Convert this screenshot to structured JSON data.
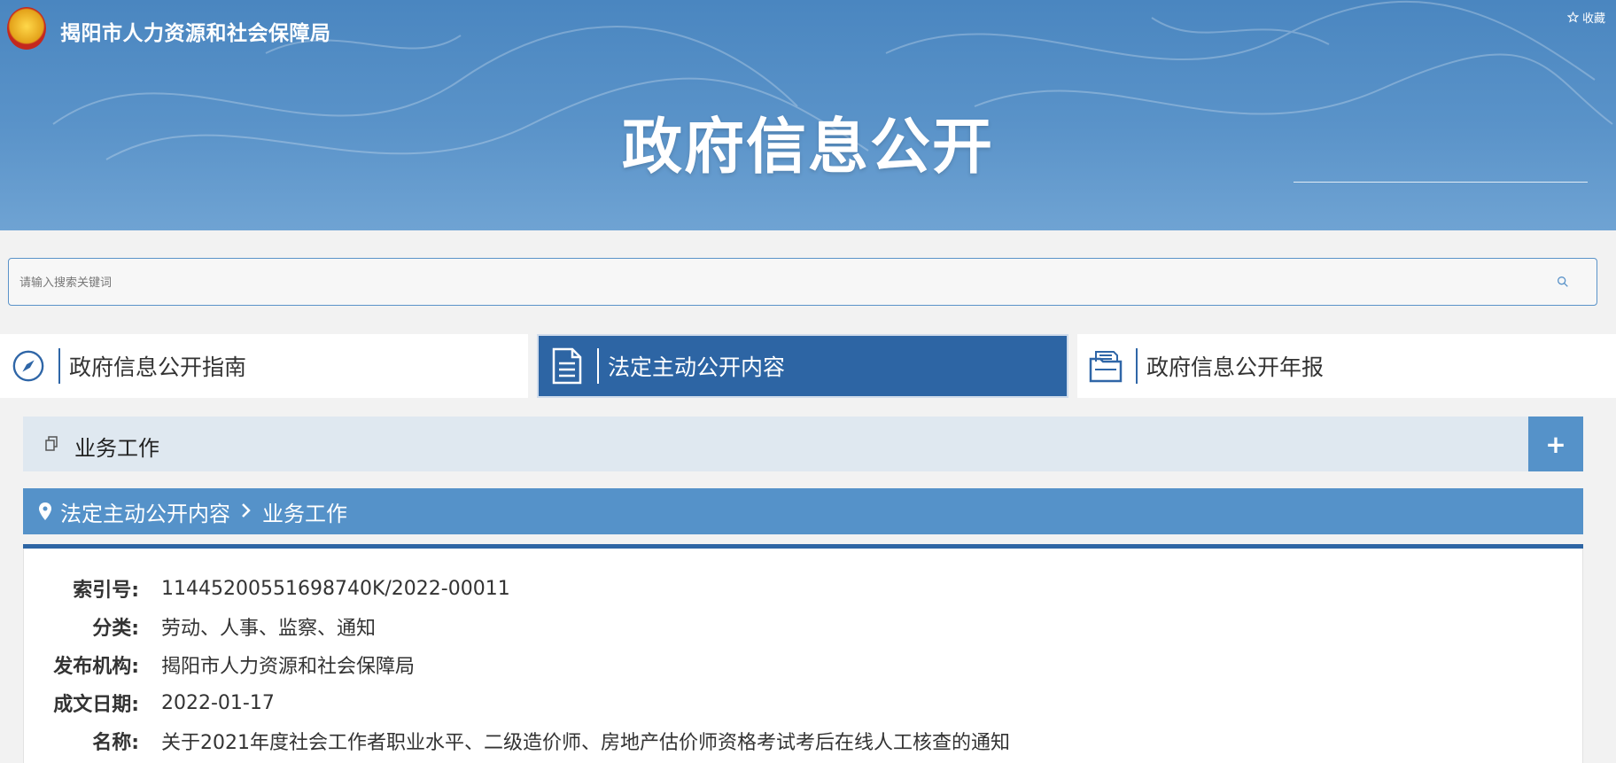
{
  "header": {
    "org_name": "揭阳市人力资源和社会保障局",
    "favorite_label": "收藏",
    "page_title": "政府信息公开"
  },
  "search": {
    "placeholder": "请输入搜索关键词"
  },
  "tabs": [
    {
      "label": "政府信息公开指南",
      "icon": "compass-icon",
      "active": false
    },
    {
      "label": "法定主动公开内容",
      "icon": "document-icon",
      "active": true
    },
    {
      "label": "政府信息公开年报",
      "icon": "folder-icon",
      "active": false
    }
  ],
  "category": {
    "label": "业务工作",
    "expand_label": "+"
  },
  "breadcrumb": {
    "items": [
      "法定主动公开内容",
      "业务工作"
    ]
  },
  "details": [
    {
      "key": "索引号:",
      "value": "11445200551698740K/2022-00011"
    },
    {
      "key": "分类:",
      "value": "劳动、人事、监察、通知"
    },
    {
      "key": "发布机构:",
      "value": "揭阳市人力资源和社会保障局"
    },
    {
      "key": "成文日期:",
      "value": "2022-01-17"
    },
    {
      "key": "名称:",
      "value": "关于2021年度社会工作者职业水平、二级造价师、房地产估价师资格考试考后在线人工核查的通知"
    }
  ],
  "colors": {
    "banner": "#4a86c0",
    "active_tab": "#2d65a4",
    "breadcrumb": "#5592c9",
    "category_bar": "#dfe8f0"
  }
}
